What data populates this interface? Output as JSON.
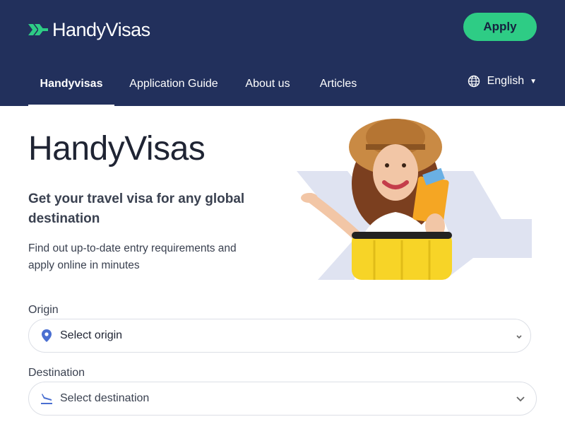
{
  "header": {
    "logo_text": "HandyVisas",
    "apply_label": "Apply",
    "colors": {
      "background": "#22305c",
      "accent": "#2ecc85"
    }
  },
  "nav": {
    "items": [
      {
        "label": "Handyvisas",
        "active": true
      },
      {
        "label": "Application Guide",
        "active": false
      },
      {
        "label": "About us",
        "active": false
      },
      {
        "label": "Articles",
        "active": false
      }
    ],
    "language": {
      "label": "English",
      "icon": "globe-icon"
    }
  },
  "hero": {
    "title": "HandyVisas",
    "subtitle": "Get your travel visa for any global destination",
    "description": "Find out up-to-date entry requirements and apply online in minutes"
  },
  "form": {
    "origin": {
      "label": "Origin",
      "value": "Select origin",
      "icon": "location-pin-icon"
    },
    "destination": {
      "label": "Destination",
      "value": "Select destination",
      "icon": "plane-landing-icon"
    }
  }
}
